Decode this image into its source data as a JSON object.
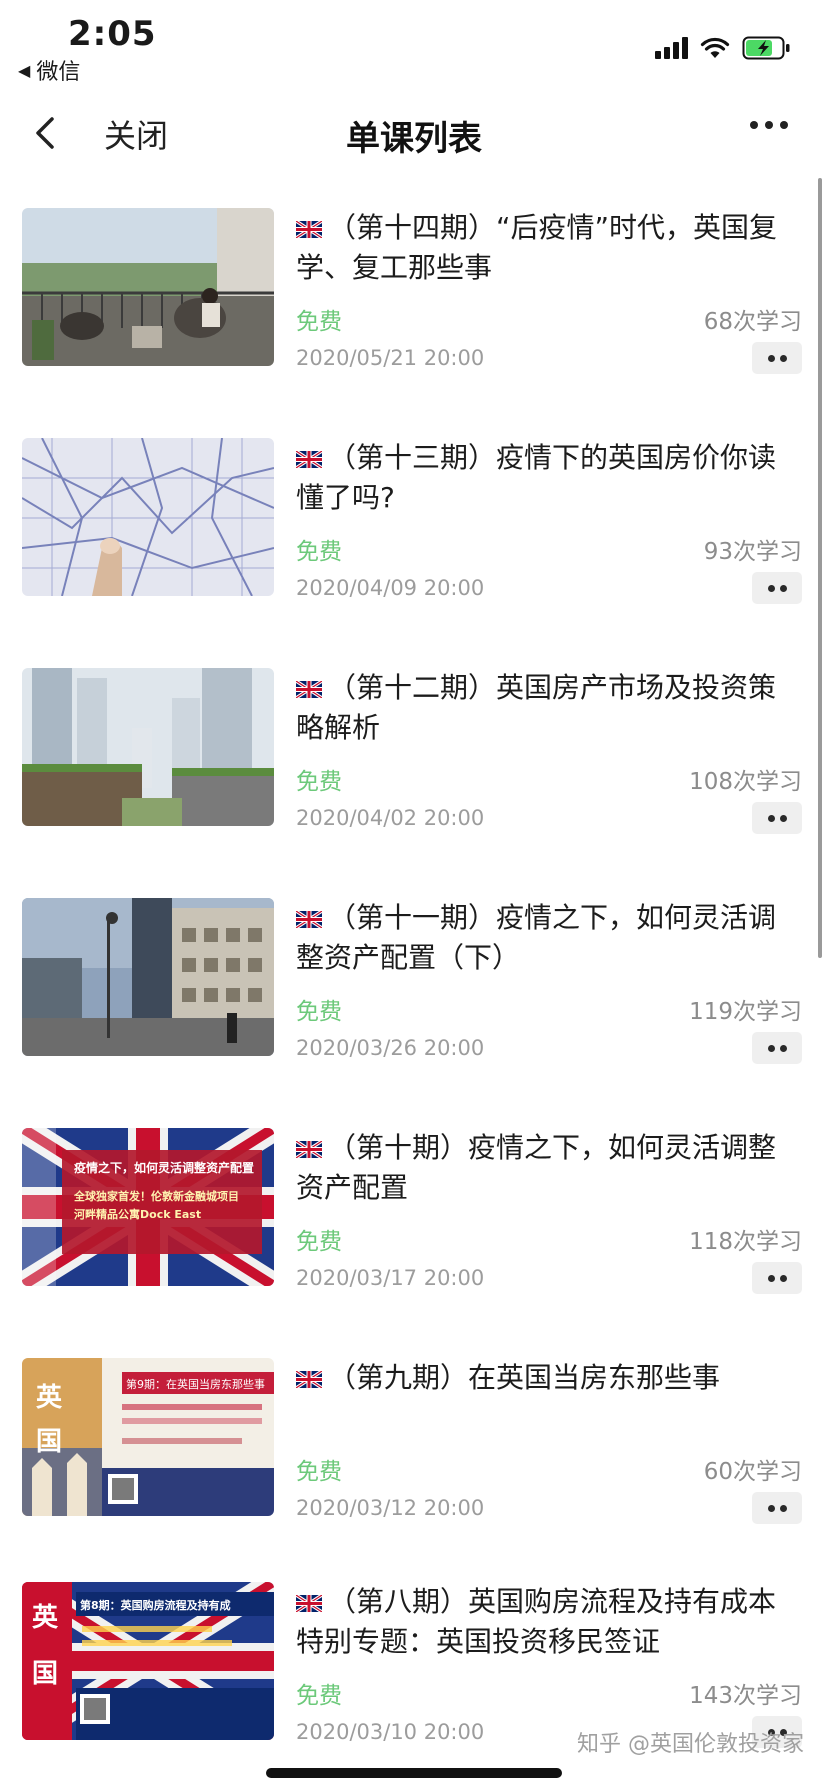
{
  "status_bar": {
    "time": "2:05",
    "back_app": "微信",
    "battery_state": "charging"
  },
  "nav": {
    "close_label": "关闭",
    "title": "单课列表"
  },
  "courses": [
    {
      "title": "（第十四期）“后疫情”时代，英国复学、复工那些事",
      "price": "免费",
      "count": "68次学习",
      "date": "2020/05/21 20:00",
      "thumb_icon": "balcony-photo"
    },
    {
      "title": "（第十三期）疫情下的英国房价你读懂了吗?",
      "price": "免费",
      "count": "93次学习",
      "date": "2020/04/09 20:00",
      "thumb_icon": "city-map-photo"
    },
    {
      "title": "（第十二期）英国房产市场及投资策略解析",
      "price": "免费",
      "count": "108次学习",
      "date": "2020/04/02 20:00",
      "thumb_icon": "city-towers-photo"
    },
    {
      "title": "（第十一期）疫情之下，如何灵活调整资产配置（下）",
      "price": "免费",
      "count": "119次学习",
      "date": "2020/03/26 20:00",
      "thumb_icon": "street-photo"
    },
    {
      "title": "（第十期）疫情之下，如何灵活调整资产配置",
      "price": "免费",
      "count": "118次学习",
      "date": "2020/03/17 20:00",
      "thumb_icon": "union-jack-poster",
      "thumb_text": {
        "line1": "疫情之下，如何灵活调整资产配置",
        "line2": "全球独家首发！伦敦新金融城项目",
        "line3": "河畔精品公寓Dock East"
      }
    },
    {
      "title": "（第九期）在英国当房东那些事",
      "price": "免费",
      "count": "60次学习",
      "date": "2020/03/12 20:00",
      "thumb_icon": "landlord-poster",
      "thumb_text": {
        "badge1": "英",
        "badge2": "国",
        "banner": "第9期：在英国当房东那些事"
      }
    },
    {
      "title": "（第八期）英国购房流程及持有成本 特别专题：英国投资移民签证",
      "price": "免费",
      "count": "143次学习",
      "date": "2020/03/10 20:00",
      "thumb_icon": "purchase-poster",
      "thumb_text": {
        "badge1": "英",
        "badge2": "国",
        "banner": "第8期：英国购房流程及持有成"
      }
    }
  ],
  "watermark": "知乎 @英国伦敦投资家",
  "colors": {
    "free_green": "#6cc97a",
    "meta_gray": "#9c9c9c",
    "pill_bg": "#efefef"
  }
}
